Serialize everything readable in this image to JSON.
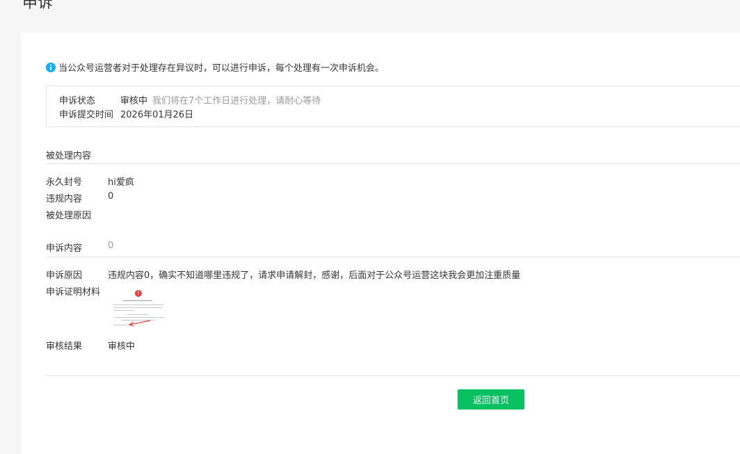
{
  "page_title": "申诉",
  "notice": {
    "icon": "info-icon",
    "text": "当公众号运营者对于处理存在异议时，可以进行申诉，每个处理有一次申诉机会。",
    "icon_color": "#10aeff"
  },
  "status_box": {
    "status_label": "申诉状态",
    "status_value": "审核中",
    "status_hint": "我们将在7个工作日进行处理，请耐心等待",
    "time_label": "申诉提交时间",
    "time_value": "2026年01月26日"
  },
  "handled": {
    "title": "被处理内容",
    "type_label": "永久封号",
    "type_value": "hi爱疯",
    "violation_label": "违规内容",
    "violation_value": "0",
    "reason_label": "被处理原因",
    "reason_value": ""
  },
  "appeal": {
    "title": "申诉内容",
    "count": "0",
    "reason_label": "申诉原因",
    "reason_value": "违规内容0，确实不知道哪里违规了，请求申请解封，感谢，后面对于公众号运营这块我会更加注重质量",
    "proof_label": "申诉证明材料",
    "result_label": "审核结果",
    "result_value": "审核中"
  },
  "back_button": {
    "label": "返回首页",
    "color": "#07c160"
  }
}
